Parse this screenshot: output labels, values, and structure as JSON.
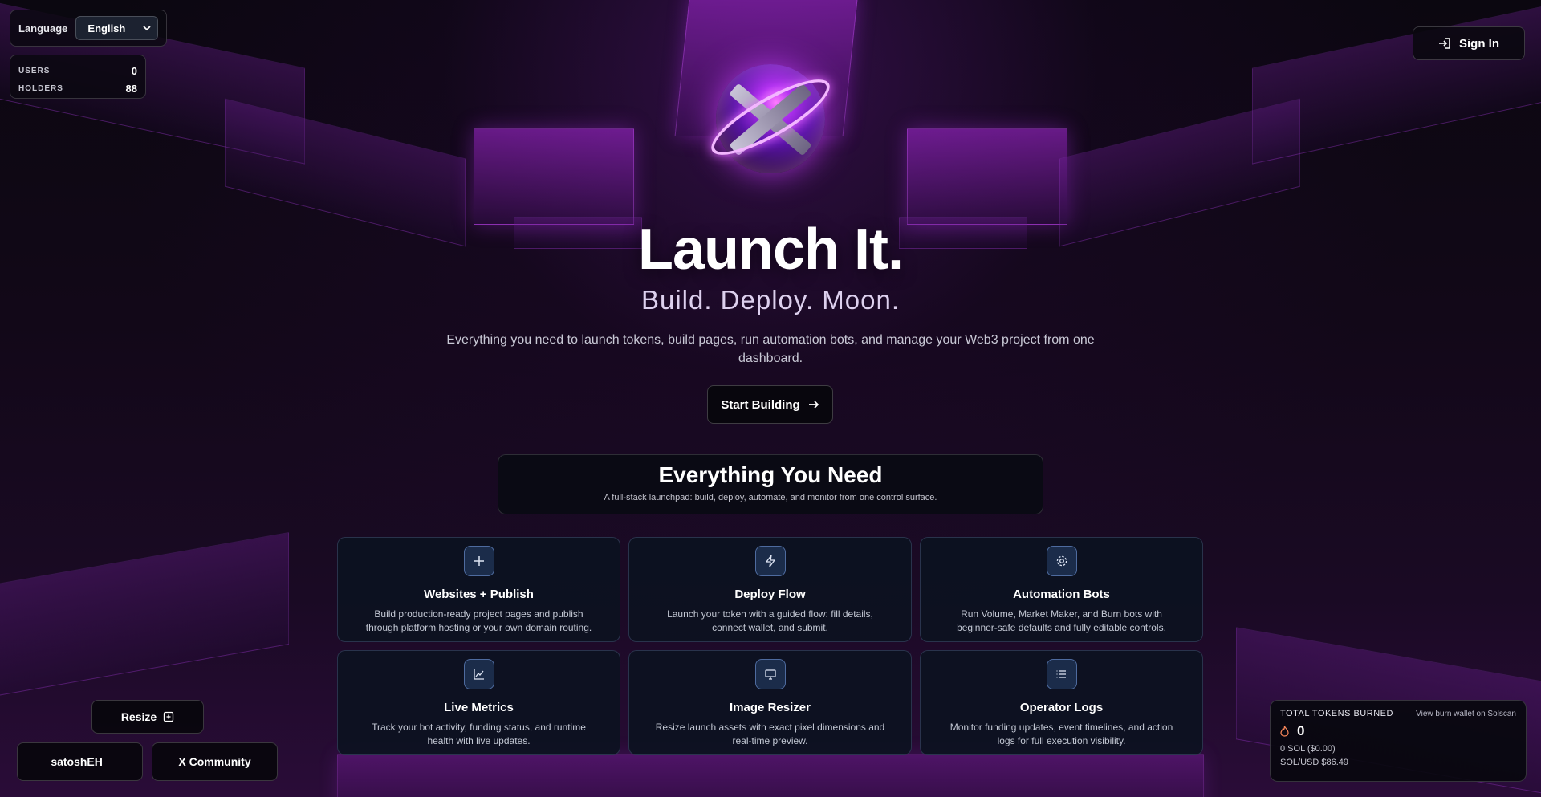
{
  "header": {
    "language_label": "Language",
    "language_value": "English",
    "sign_in_label": "Sign In"
  },
  "stats": {
    "users_label": "USERS",
    "users_value": "0",
    "holders_label": "HOLDERS",
    "holders_value": "88"
  },
  "hero": {
    "title": "Launch It.",
    "subtitle": "Build. Deploy. Moon.",
    "description": "Everything you need to launch tokens, build pages, run automation bots, and manage your Web3 project from one dashboard.",
    "cta_label": "Start Building"
  },
  "features_section": {
    "title": "Everything You Need",
    "subtitle": "A full-stack launchpad: build, deploy, automate, and monitor from one control surface."
  },
  "features": [
    {
      "title": "Websites + Publish",
      "description": "Build production-ready project pages and publish through platform hosting or your own domain routing.",
      "icon": "plus-icon"
    },
    {
      "title": "Deploy Flow",
      "description": "Launch your token with a guided flow: fill details, connect wallet, and submit.",
      "icon": "lightning-icon"
    },
    {
      "title": "Automation Bots",
      "description": "Run Volume, Market Maker, and Burn bots with beginner-safe defaults and fully editable controls.",
      "icon": "gear-icon"
    },
    {
      "title": "Live Metrics",
      "description": "Track your bot activity, funding status, and runtime health with live updates.",
      "icon": "chart-icon"
    },
    {
      "title": "Image Resizer",
      "description": "Resize launch assets with exact pixel dimensions and real-time preview.",
      "icon": "monitor-icon"
    },
    {
      "title": "Operator Logs",
      "description": "Monitor funding updates, event timelines, and action logs for full execution visibility.",
      "icon": "list-icon"
    }
  ],
  "footer": {
    "resize_label": "Resize",
    "satosh_label": "satoshEH_",
    "community_label": "X Community"
  },
  "burn": {
    "label": "TOTAL TOKENS BURNED",
    "link_label": "View burn wallet on Solscan",
    "count": "0",
    "sol": "0 SOL ($0.00)",
    "price": "SOL/USD $86.49"
  },
  "colors": {
    "accent": "#b030f0",
    "card_bg": "#0c1220",
    "icon_bg": "#1b2c4a"
  }
}
